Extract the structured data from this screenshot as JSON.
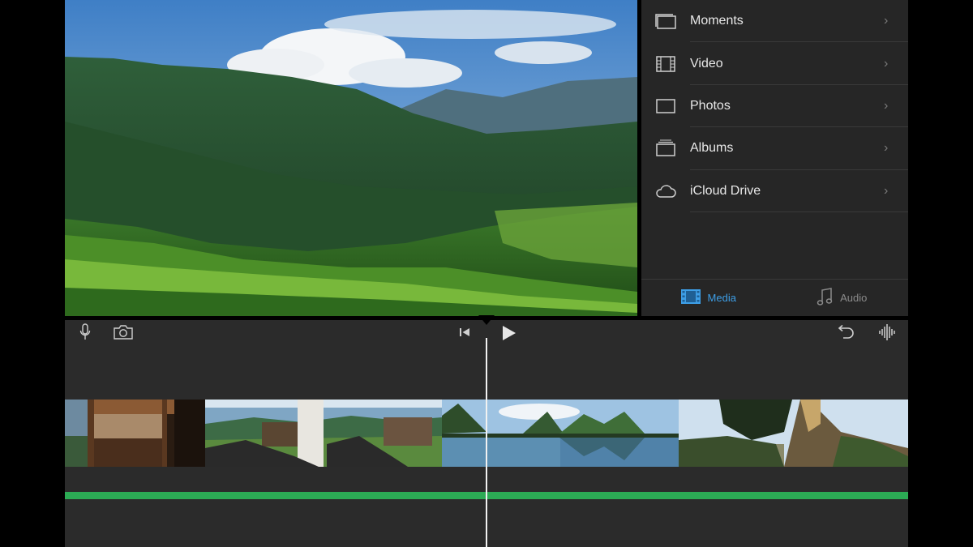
{
  "media_browser": {
    "items": [
      {
        "label": "Moments",
        "icon": "moments-icon"
      },
      {
        "label": "Video",
        "icon": "film-icon"
      },
      {
        "label": "Photos",
        "icon": "photo-frame-icon"
      },
      {
        "label": "Albums",
        "icon": "albums-icon"
      },
      {
        "label": "iCloud Drive",
        "icon": "cloud-icon"
      }
    ],
    "tabs": [
      {
        "label": "Media",
        "icon": "film-icon",
        "active": true
      },
      {
        "label": "Audio",
        "icon": "music-note-icon",
        "active": false
      }
    ]
  },
  "timeline": {
    "toolbar": {
      "left": [
        "microphone-icon",
        "camera-icon"
      ],
      "center": [
        "skip-to-start-icon",
        "play-icon"
      ],
      "right": [
        "undo-icon",
        "audio-waveform-icon"
      ]
    },
    "audio_track_color": "#2cab55",
    "playhead_color": "#f2f2f2"
  },
  "colors": {
    "accent": "#3d9ee6",
    "panel": "#262626",
    "timeline_bg": "#2b2b2b"
  }
}
